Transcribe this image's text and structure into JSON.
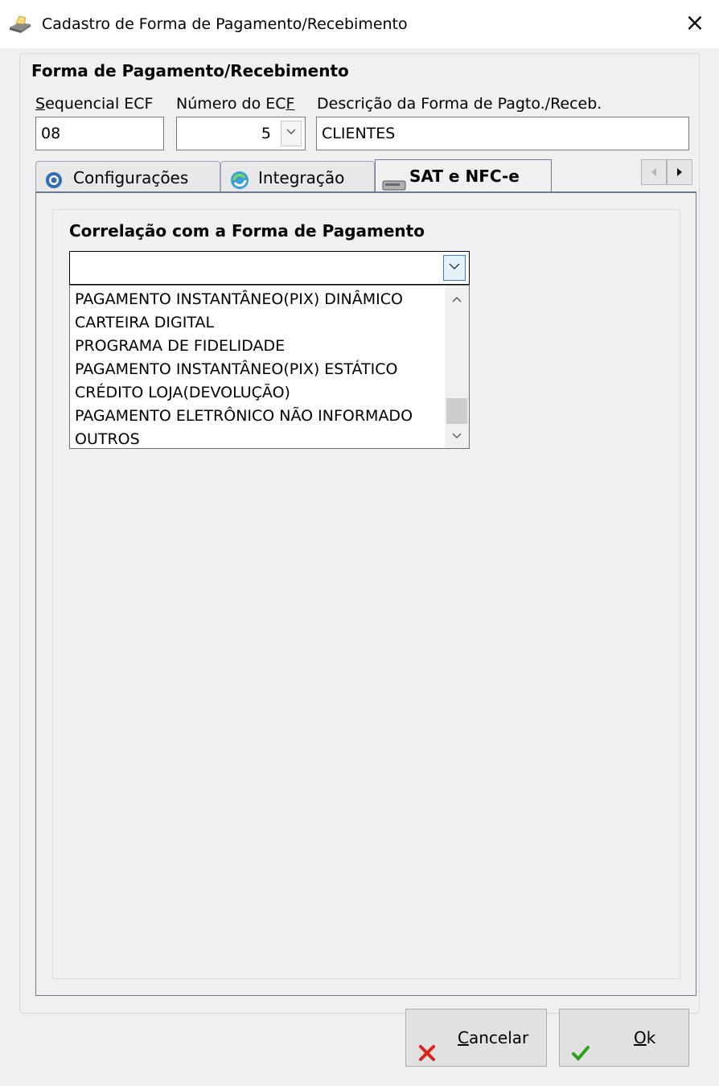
{
  "window": {
    "title": "Cadastro de Forma de Pagamento/Recebimento",
    "close_glyph": "×",
    "icon": "printer-icon"
  },
  "group": {
    "title": "Forma de Pagamento/Recebimento"
  },
  "fields": {
    "sequencial": {
      "label_prefix": "S",
      "label_rest": "equencial ECF",
      "value": "08"
    },
    "numero": {
      "label_main": "Número do EC",
      "label_access": "F",
      "value": "5"
    },
    "descricao": {
      "label": "Descrição da Forma de Pagto./Receb.",
      "value": "CLIENTES"
    }
  },
  "tabs": [
    {
      "label": "Configurações",
      "icon": "gear-icon",
      "active": false
    },
    {
      "label": "Integração",
      "icon": "sync-icon",
      "active": false
    },
    {
      "label": "SAT e NFC-e",
      "icon": "drive-icon",
      "active": true
    }
  ],
  "panel": {
    "correlation_label": "Correlação com a Forma de Pagamento",
    "combo_value": "",
    "dropdown_items": [
      "PAGAMENTO INSTANTÂNEO(PIX) DINÂMICO",
      "CARTEIRA DIGITAL",
      "PROGRAMA DE FIDELIDADE",
      "PAGAMENTO INSTANTÂNEO(PIX) ESTÁTICO",
      "CRÉDITO LOJA(DEVOLUÇÃO)",
      "PAGAMENTO ELETRÔNICO NÃO INFORMADO",
      "OUTROS"
    ]
  },
  "buttons": {
    "cancel": {
      "access": "C",
      "rest": "ancelar",
      "icon": "x-icon",
      "color": "#d9231b"
    },
    "ok": {
      "access": "O",
      "rest": "k",
      "icon": "check-icon",
      "color": "#2f9e1e"
    }
  }
}
